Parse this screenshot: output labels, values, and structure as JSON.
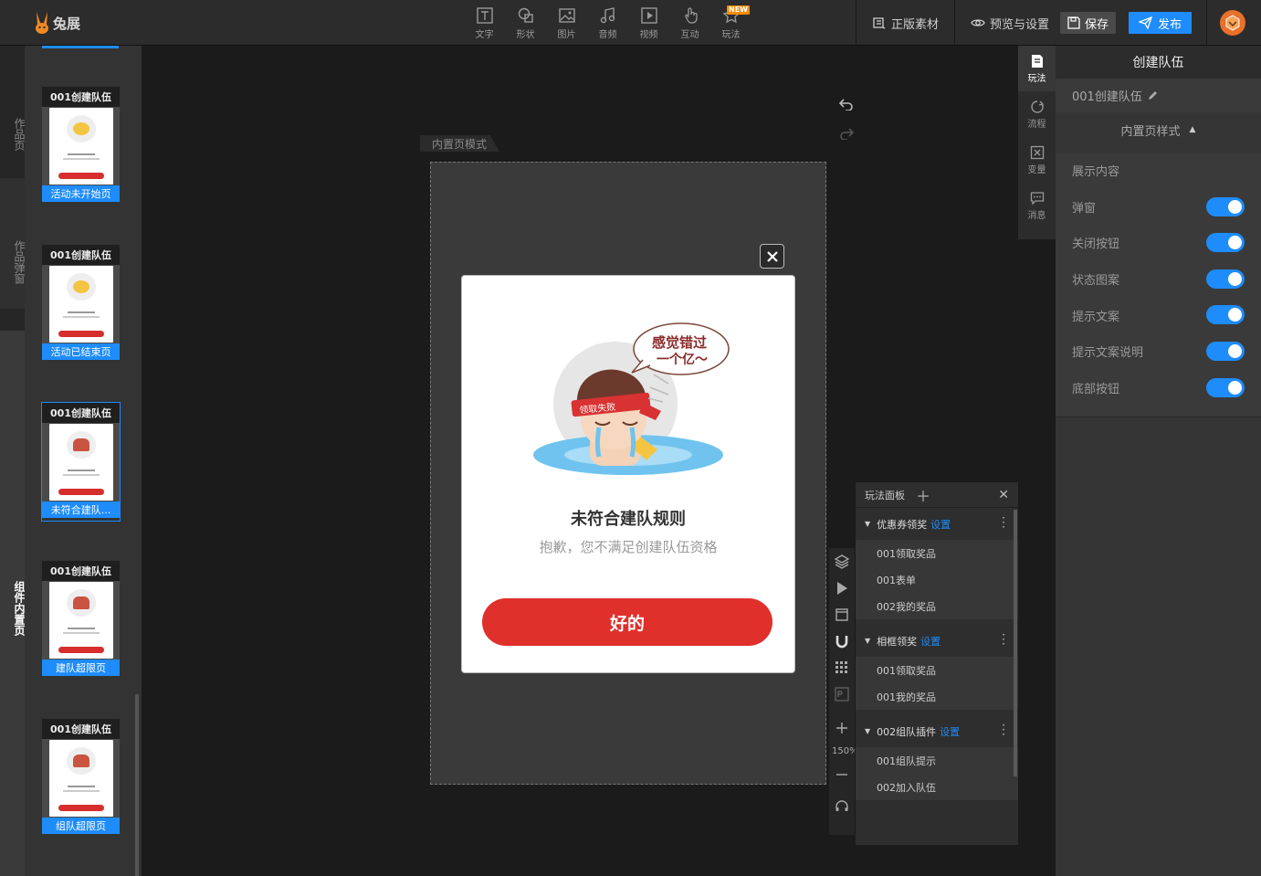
{
  "app": {
    "logo_text": "兔展"
  },
  "toolbar": {
    "tools": [
      {
        "label": "文字",
        "icon": "text-icon"
      },
      {
        "label": "形状",
        "icon": "shape-icon"
      },
      {
        "label": "图片",
        "icon": "image-icon"
      },
      {
        "label": "音频",
        "icon": "audio-icon"
      },
      {
        "label": "视频",
        "icon": "video-icon"
      },
      {
        "label": "互动",
        "icon": "interaction-icon"
      },
      {
        "label": "玩法",
        "icon": "play-icon"
      }
    ],
    "new_badge": "NEW",
    "genuine_material": "正版素材",
    "preview_settings": "预览与设置",
    "save": "保存",
    "publish": "发布"
  },
  "left_tabs": [
    "作品页",
    "作品弹窗",
    "组件内置页"
  ],
  "thumbnails": [
    {
      "title": "001创建队伍",
      "label": "活动未开始页"
    },
    {
      "title": "001创建队伍",
      "label": "活动已结束页"
    },
    {
      "title": "001创建队伍",
      "label": "未符合建队..."
    },
    {
      "title": "001创建队伍",
      "label": "建队超限页"
    },
    {
      "title": "001创建队伍",
      "label": "组队超限页"
    }
  ],
  "canvas": {
    "mode_tag": "内置页模式",
    "modal": {
      "bubble_text_1": "感觉错过",
      "bubble_text_2": "一个亿～",
      "headband_text": "领取失败",
      "title": "未符合建队规则",
      "subtitle": "抱歉，您不满足创建队伍资格",
      "button": "好的"
    },
    "zoom_level": "150%"
  },
  "play_panel": {
    "title": "玩法面板",
    "groups": [
      {
        "name": "优惠券领奖",
        "set": "设置",
        "items": [
          "001领取奖品",
          "001表单",
          "002我的奖品"
        ]
      },
      {
        "name": "相框领奖",
        "set": "设置",
        "items": [
          "001领取奖品",
          "001我的奖品"
        ]
      },
      {
        "name": "002组队插件",
        "set": "设置",
        "items": [
          "001组队提示",
          "002加入队伍"
        ]
      }
    ]
  },
  "right_tabs": [
    "玩法",
    "流程",
    "变量",
    "消息"
  ],
  "right_panel": {
    "title": "创建队伍",
    "name": "001创建队伍",
    "style_section": "内置页样式",
    "content_label": "展示内容",
    "toggles": [
      {
        "label": "弹窗",
        "on": true
      },
      {
        "label": "关闭按钮",
        "on": true
      },
      {
        "label": "状态图案",
        "on": true
      },
      {
        "label": "提示文案",
        "on": true
      },
      {
        "label": "提示文案说明",
        "on": true
      },
      {
        "label": "底部按钮",
        "on": true
      }
    ]
  },
  "colors": {
    "accent": "#1e8cfa",
    "button_red": "#e0302b",
    "badge_orange": "#ff8a00"
  }
}
